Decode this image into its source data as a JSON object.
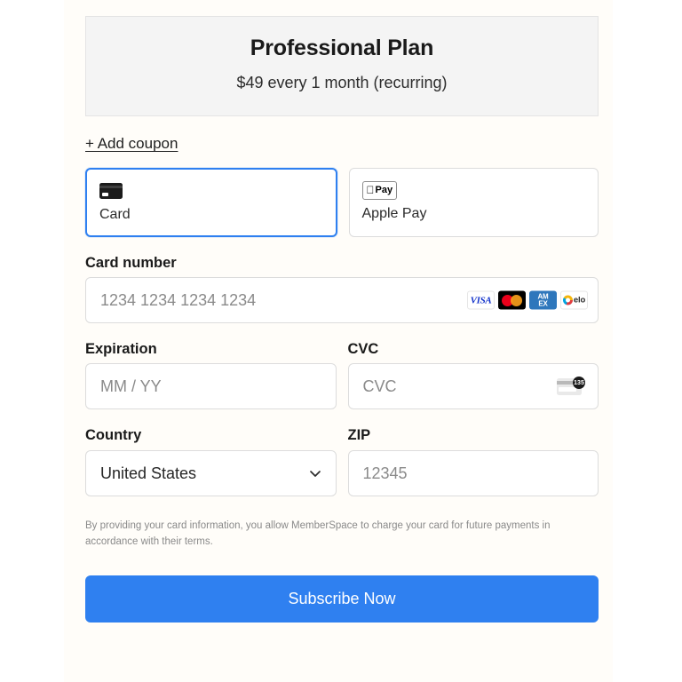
{
  "plan": {
    "title": "Professional Plan",
    "price_line": "$49 every 1 month (recurring)"
  },
  "coupon": {
    "link_label": "+ Add coupon"
  },
  "payment_methods": {
    "selected": "Card",
    "tabs": [
      {
        "label": "Card",
        "icon": "credit-card-icon",
        "selected": true
      },
      {
        "label": "Apple Pay",
        "icon": "apple-pay-icon",
        "selected": false
      }
    ],
    "apple_pay_badge": {
      "apple_mark": "",
      "pay_text": "Pay"
    }
  },
  "form": {
    "card_number": {
      "label": "Card number",
      "placeholder": "1234 1234 1234 1234",
      "value": ""
    },
    "expiration": {
      "label": "Expiration",
      "placeholder": "MM / YY",
      "value": ""
    },
    "cvc": {
      "label": "CVC",
      "placeholder": "CVC",
      "value": "",
      "hint_icon_number": "135"
    },
    "country": {
      "label": "Country",
      "value": "United States"
    },
    "zip": {
      "label": "ZIP",
      "placeholder": "12345",
      "value": ""
    }
  },
  "card_brands": [
    {
      "name": "visa",
      "text": "VISA"
    },
    {
      "name": "mastercard",
      "text": ""
    },
    {
      "name": "amex",
      "line1": "AM",
      "line2": "EX"
    },
    {
      "name": "elo",
      "text": "elo"
    }
  ],
  "disclaimer": {
    "text": "By providing your card information, you allow MemberSpace to charge your card for future payments in accordance with their terms."
  },
  "submit": {
    "label": "Subscribe Now"
  },
  "colors": {
    "accent_blue": "#2f80f0",
    "panel_background": "#fffdf9",
    "plan_box_background": "#f4f4f4",
    "border_gray": "#dcdcdc",
    "placeholder_gray": "#8a8a8a",
    "visa_blue": "#1434cb",
    "amex_blue": "#2e77bc",
    "mastercard_red": "#eb001b",
    "mastercard_orange": "#f79e1b"
  }
}
